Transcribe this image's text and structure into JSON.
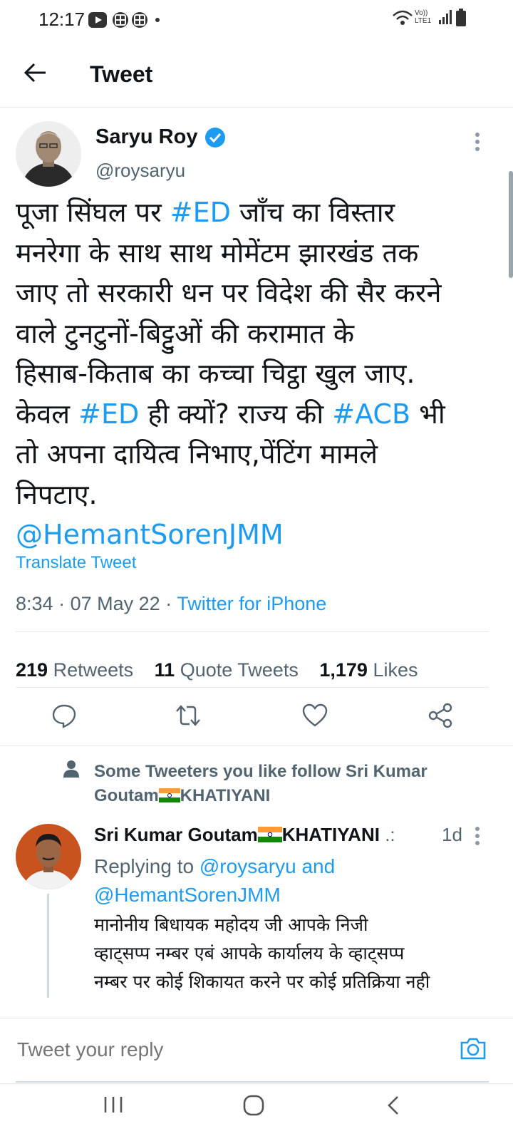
{
  "status_bar": {
    "time": "12:17",
    "network_label": "Vo)) LTE1"
  },
  "header": {
    "title": "Tweet"
  },
  "tweet": {
    "author_name": "Saryu Roy",
    "author_handle": "@roysaryu",
    "text_runs": [
      {
        "t": "पूजा सिंघल पर "
      },
      {
        "t": "#ED",
        "link": true
      },
      {
        "t": " जाँच का विस्तार\nमनरेगा के साथ साथ मोमेंटम झारखंड तक\nजाए तो सरकारी धन पर विदेश की सैर करने\nवाले टुनटुनों-बिट्टुओं की करामात के\nहिसाब-किताब का कच्चा चिट्ठा खुल जाए.\nकेवल "
      },
      {
        "t": "#ED",
        "link": true
      },
      {
        "t": " ही क्यों? राज्य की "
      },
      {
        "t": "#ACB",
        "link": true
      },
      {
        "t": " भी\nतो अपना दायित्व निभाए,पेंटिंग मामले\nनिपटाए.\n"
      },
      {
        "t": "@HemantSorenJMM",
        "link": true
      }
    ],
    "translate_label": "Translate Tweet",
    "time": "8:34",
    "date": "07 May 22",
    "source": "Twitter for iPhone",
    "separator": "·",
    "stats": {
      "retweets_count": "219",
      "retweets_label": "Retweets",
      "quotes_count": "11",
      "quotes_label": "Quote Tweets",
      "likes_count": "1,179",
      "likes_label": "Likes"
    }
  },
  "social_context": {
    "text_before": "Some Tweeters you like follow Sri Kumar Goutam",
    "text_after": "KHATIYANI"
  },
  "reply": {
    "author_name_before": "Sri Kumar Goutam",
    "author_name_after": "KHATIYANI",
    "ellipsis": ".:",
    "time_ago": "1d",
    "replying_label": "Replying to",
    "replying_to_1": "@roysaryu",
    "and_label": "and",
    "replying_to_2": "@HemantSorenJMM",
    "text": "मानोनीय बिधायक महोदय जी आपके निजी\nव्हाट्सप्प नम्बर एबं आपके कार्यालय के व्हाट्सप्प\nनम्बर पर कोई शिकायत करने पर कोई प्रतिक्रिया नही"
  },
  "reply_bar": {
    "placeholder": "Tweet your reply"
  },
  "colors": {
    "accent": "#1d9bf0",
    "text": "#0f1419",
    "muted": "#536471",
    "verified": "#1d9bf0"
  }
}
